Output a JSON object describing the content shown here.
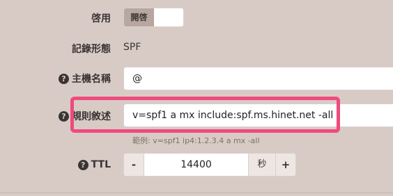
{
  "enable": {
    "label": "啓用",
    "toggle_on": "開啓"
  },
  "record_type": {
    "label": "記錄形態",
    "value": "SPF"
  },
  "hostname": {
    "label": "主機名稱",
    "value": "@"
  },
  "rule": {
    "label": "規則敘述",
    "value": "v=spf1 a mx include:spf.ms.hinet.net -all",
    "example": "範例: v=spf1 ip4:1.2.3.4 a mx -all"
  },
  "ttl": {
    "label": "TTL",
    "minus": "-",
    "value": "14400",
    "unit": "秒",
    "plus": "+"
  },
  "icons": {
    "help": "question-circle-icon"
  },
  "colors": {
    "highlight": "#ef4a7e",
    "background": "#d8cbc6"
  }
}
